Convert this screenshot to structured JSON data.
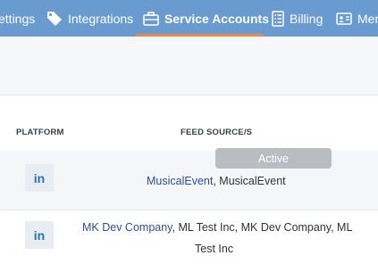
{
  "nav": {
    "items": [
      {
        "label": "ettings",
        "icon": "gear-icon"
      },
      {
        "label": "Integrations",
        "icon": "tag-icon"
      },
      {
        "label": "Service Accounts",
        "icon": "briefcase-icon",
        "active": true
      },
      {
        "label": "Billing",
        "icon": "checklist-icon"
      },
      {
        "label": "Mer",
        "icon": "id-card-icon"
      }
    ]
  },
  "table": {
    "headers": {
      "platform": "PLATFORM",
      "feed_sources": "FEED SOURCE/S"
    },
    "rows": [
      {
        "platform": "in",
        "feed_link": "MusicalEvent",
        "feed_rest": ", MusicalEvent"
      },
      {
        "platform": "in",
        "feed_link": "MK Dev Company",
        "feed_rest_line1": ", ML Test Inc, MK Dev Company, ML",
        "feed_rest_line2": "Test Inc"
      }
    ]
  },
  "tooltip": {
    "text": "Active"
  },
  "colors": {
    "nav_bg": "#6a9bd0",
    "nav_accent": "#ec8a4a",
    "link": "#2e4f93"
  }
}
